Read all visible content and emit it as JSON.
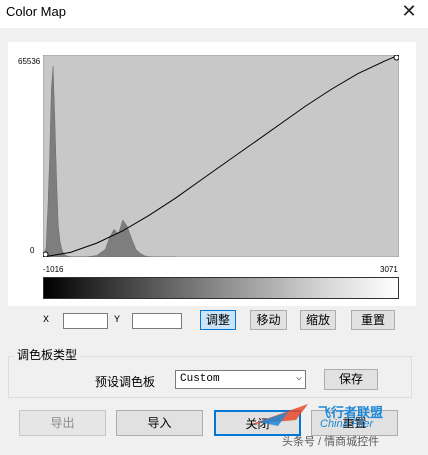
{
  "window": {
    "title": "Color Map",
    "close_glyph": "✕"
  },
  "chart_data": {
    "type": "area",
    "title": "",
    "xlabel": "",
    "ylabel": "",
    "xlim": [
      -1016,
      3071
    ],
    "ylim": [
      0,
      65536
    ],
    "tick_labels": {
      "y_top": "65536",
      "y_bottom": "0",
      "x_left": "-1016",
      "x_right": "3071"
    },
    "histogram": {
      "x": [
        -1016,
        -980,
        -960,
        -940,
        -920,
        -900,
        -880,
        -860,
        -840,
        -820,
        -800,
        -780,
        -760,
        -700,
        -600,
        -500,
        -400,
        -300,
        -250,
        -200,
        -150,
        -100,
        -50,
        0,
        50,
        100,
        150,
        200,
        300,
        400,
        500
      ],
      "y": [
        0,
        3000,
        16000,
        32000,
        55000,
        62000,
        45000,
        25000,
        10000,
        5000,
        2500,
        1200,
        500,
        100,
        50,
        100,
        500,
        2500,
        6500,
        9000,
        7500,
        12000,
        10000,
        6000,
        2500,
        1200,
        400,
        100,
        0,
        0,
        0
      ]
    },
    "transfer_curve": {
      "x": [
        -1016,
        -700,
        -400,
        -100,
        200,
        500,
        800,
        1100,
        1400,
        1700,
        2000,
        2300,
        2600,
        2900,
        3071
      ],
      "y": [
        0,
        1500,
        4500,
        8500,
        13500,
        19000,
        25000,
        31000,
        37000,
        43000,
        49000,
        54500,
        59500,
        63500,
        65536
      ]
    }
  },
  "controls": {
    "x_label": "X",
    "y_label": "Y",
    "x_value": "",
    "y_value": "",
    "adjust": "调整",
    "move": "移动",
    "scale": "缩放",
    "reset_top": "重置"
  },
  "palette": {
    "group_label": "调色板类型",
    "preset_label": "预设调色板",
    "preset_value": "Custom",
    "save": "保存"
  },
  "bottom": {
    "export": "导出",
    "import": "导入",
    "close": "关闭",
    "reset": "重置"
  },
  "watermark": {
    "brand_cn": "飞行者联盟",
    "brand_en": "China Flier",
    "account": "头条号 / 情商城控件"
  },
  "colors": {
    "accent": "#0078d7",
    "hist": "#7e7e7e",
    "plot_bg": "#c8c8c8"
  }
}
